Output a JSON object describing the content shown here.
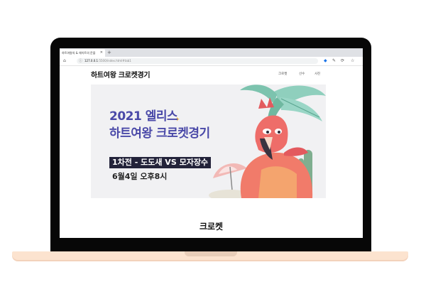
{
  "browser": {
    "tab_title": "하트여왕의 & 체이트의 문을",
    "url_host": "127.0.0.1",
    "url_path": ":5500/index.html#tab1"
  },
  "site": {
    "title": "하트여왕 크로켓경기",
    "nav": [
      "크로켓",
      "선수",
      "사진"
    ]
  },
  "banner": {
    "title_line1": "2021 엘리스",
    "title_line2": "하트여왕 크로켓경기",
    "match": "1차전 - 도도새 VS 모자장수",
    "date": "6월4일 오후8시"
  },
  "main": {
    "section_title": "크로켓"
  },
  "colors": {
    "accent": "#4a49a8",
    "laptop_base": "#fce3cf",
    "bezel": "#070707"
  }
}
